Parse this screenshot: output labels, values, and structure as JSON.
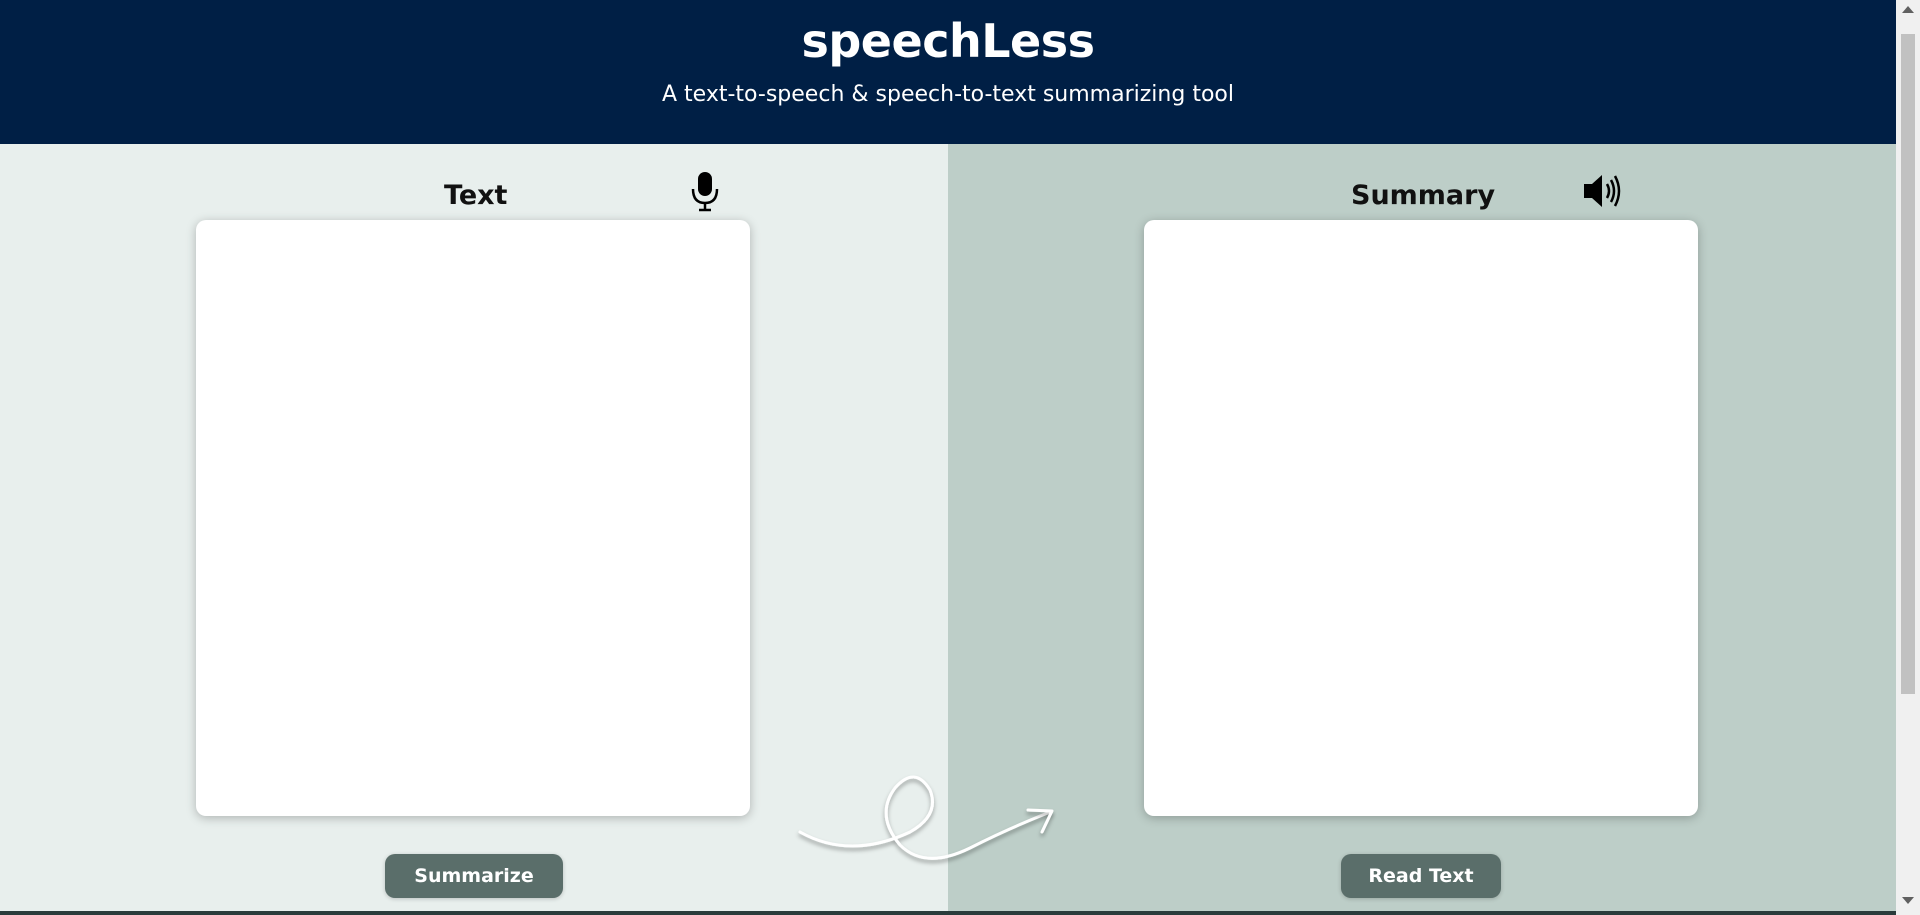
{
  "header": {
    "title": "speechLess",
    "subtitle": "A text-to-speech & speech-to-text summarizing tool"
  },
  "input_panel": {
    "heading": "Text",
    "textbox_value": "",
    "icon": "microphone-icon",
    "button_label": "Summarize"
  },
  "output_panel": {
    "heading": "Summary",
    "textbox_value": "",
    "icon": "speaker-icon",
    "button_label": "Read Text"
  },
  "colors": {
    "header_bg": "#001f45",
    "left_bg": "#e8efed",
    "right_bg": "#bdcec8",
    "button_bg": "#5a6e6a"
  }
}
